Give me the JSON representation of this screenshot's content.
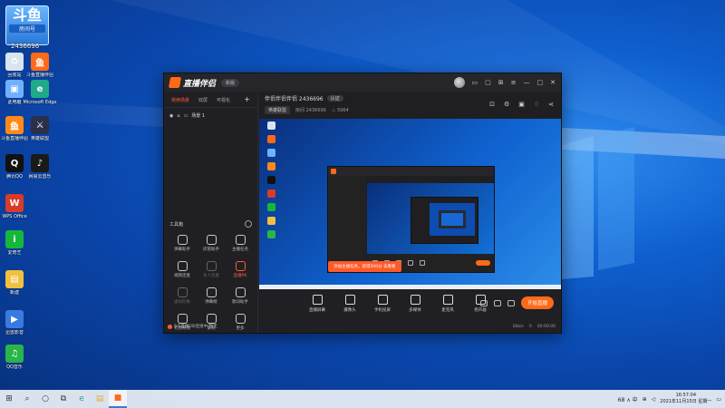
{
  "desktop": {
    "badge": {
      "big": "斗鱼",
      "sub": "房间号",
      "number": "2436696"
    },
    "icons": [
      {
        "label": "回收站",
        "color": "#d8e4f0",
        "glyph": "♻"
      },
      {
        "label": "斗鱼直播伴侣",
        "color": "#ff6a1a",
        "glyph": "鱼"
      },
      {
        "label": "此电脑",
        "color": "#6fb1ff",
        "glyph": "▣"
      },
      {
        "label": "Microsoft Edge",
        "color": "#1faa8a",
        "glyph": "e"
      },
      {
        "label": "斗鱼直播伴侣",
        "color": "#ff8a1a",
        "glyph": "鱼"
      },
      {
        "label": "英雄联盟",
        "color": "#2a2f4a",
        "glyph": "⚔"
      },
      {
        "label": "腾讯QQ",
        "color": "#111111",
        "glyph": "Q"
      },
      {
        "label": "网易云音乐",
        "color": "#1a1a1a",
        "glyph": "♪"
      },
      {
        "label": "WPS Office",
        "color": "#d93a2a",
        "glyph": "W"
      },
      {
        "label": "爱奇艺",
        "color": "#15b83a",
        "glyph": "i"
      },
      {
        "label": "新建",
        "color": "#f0c040",
        "glyph": "▤"
      },
      {
        "label": "迅雷影音",
        "color": "#3a7ae0",
        "glyph": "▶"
      },
      {
        "label": "QQ音乐",
        "color": "#2ab548",
        "glyph": "♫"
      }
    ]
  },
  "app": {
    "title": "直播伴侣",
    "version": "新版",
    "tabs": [
      "常用场景",
      "双屏",
      "可视化"
    ],
    "scene": "场景 1",
    "room_line": "伴侣伴侣伴侣 2436696",
    "verify": "认证",
    "category": "英雄联盟",
    "room_id": "2436696",
    "hot": "5964",
    "tools_title": "工具箱",
    "tools": [
      {
        "label": "弹幕助手",
        "state": "normal"
      },
      {
        "label": "房管助手",
        "state": "normal"
      },
      {
        "label": "主播任务",
        "state": "normal"
      },
      {
        "label": "视频连麦",
        "state": "normal"
      },
      {
        "label": "多人连麦",
        "state": "dim"
      },
      {
        "label": "直播PK",
        "state": "hot"
      },
      {
        "label": "虚拟形象",
        "state": "dim"
      },
      {
        "label": "弹幕姬",
        "state": "normal"
      },
      {
        "label": "歌词助手",
        "state": "normal"
      },
      {
        "label": "礼物特效",
        "state": "normal"
      },
      {
        "label": "录制",
        "state": "normal"
      },
      {
        "label": "更多",
        "state": "normal"
      }
    ],
    "status_text": "5/5直播间0连接中/暂无",
    "banner": "添加主播任务，获得500分 去看看",
    "bottom_tools": [
      "直播屏幕",
      "摄像头",
      "手机投屏",
      "多媒体",
      "麦克风",
      "扬声器"
    ],
    "go_live": "开始直播",
    "stats": [
      "0kb/s",
      "0",
      "00:00:00"
    ]
  },
  "taskbar": {
    "tray_text": "68 ∧ 中",
    "time": "16:57:04",
    "date": "2021年11月15日 星期一"
  }
}
